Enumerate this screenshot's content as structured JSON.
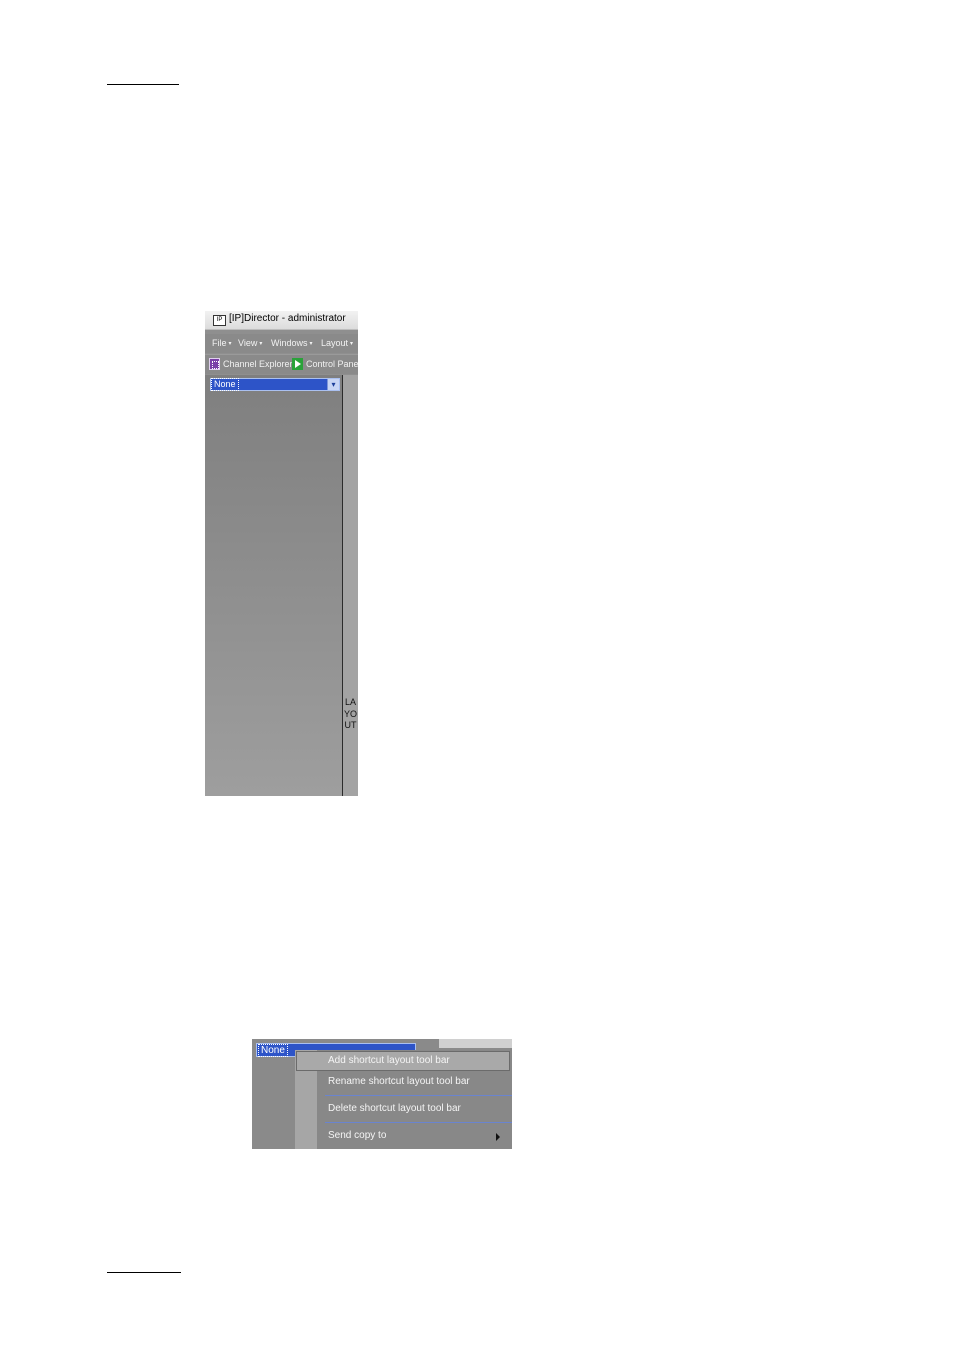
{
  "app_window": {
    "title": "[IP]Director - administrator",
    "icon_text": "IP",
    "menu": [
      {
        "label": "File"
      },
      {
        "label": "View"
      },
      {
        "label": "Windows"
      },
      {
        "label": "Layout"
      }
    ],
    "menu_caret": "▾",
    "toolbar": {
      "channel_explorer": "Channel Explorer",
      "control_panel": "Control Panel"
    },
    "layout_select": {
      "value": "None",
      "dropdown_glyph": "▾"
    },
    "side_tab_label": "LAYOUT",
    "icons": [
      "app-icon",
      "channel-explorer-icon",
      "control-panel-icon",
      "chevron-down-icon"
    ]
  },
  "context_screenshot": {
    "select_value": "None",
    "menu_items": [
      {
        "label": "Add shortcut layout tool bar"
      },
      {
        "label": "Rename shortcut layout tool bar"
      },
      {
        "label": "Delete shortcut layout tool bar"
      },
      {
        "label": "Send copy to"
      }
    ],
    "icons": [
      "submenu-arrow-icon"
    ],
    "colors": {
      "highlight": "#a9a9a9",
      "select_blue": "#2d54c8"
    }
  }
}
